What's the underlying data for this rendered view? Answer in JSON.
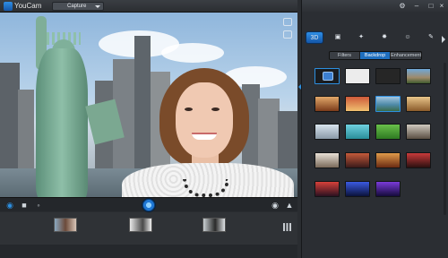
{
  "app": {
    "title": "YouCam",
    "mode_selected": "Capture"
  },
  "right_panel": {
    "categories": [
      {
        "label": "3D",
        "active": true
      },
      {
        "label": "frame",
        "active": false
      },
      {
        "label": "magic",
        "active": false
      },
      {
        "label": "emotion",
        "active": false
      },
      {
        "label": "avatar",
        "active": false
      },
      {
        "label": "brush",
        "active": false
      }
    ],
    "tabs": [
      {
        "label": "Filters",
        "active": false
      },
      {
        "label": "Backdrop",
        "active": true
      },
      {
        "label": "Enhancement",
        "active": false
      }
    ]
  },
  "colors": {
    "accent": "#1f77d4",
    "panel_bg": "#2b2e33"
  }
}
